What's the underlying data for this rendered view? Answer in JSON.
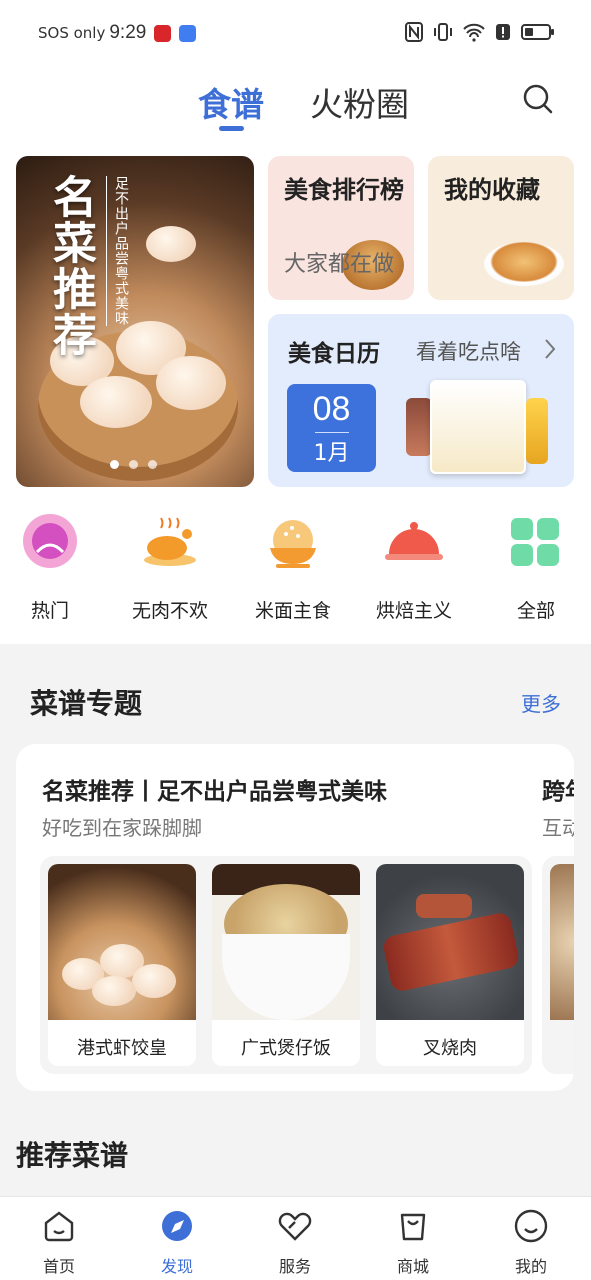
{
  "status_bar": {
    "carrier": "SOS only",
    "time": "9:29",
    "badge_colors": [
      "#d9262a",
      "#3f7df0"
    ]
  },
  "header": {
    "tabs": [
      {
        "label": "食谱",
        "active": true
      },
      {
        "label": "火粉圈",
        "active": false
      }
    ],
    "search_icon": "search-icon",
    "accent_color": "#3d6fd6"
  },
  "banner": {
    "title": "名菜推荐",
    "subtitle": "足不出户品尝粤式美味",
    "page_count": 3,
    "current_page": 1
  },
  "cards": {
    "ranking": {
      "title": "美食排行榜",
      "subtitle": "大家都在做"
    },
    "favorites": {
      "title": "我的收藏"
    },
    "calendar": {
      "title": "美食日历",
      "link": "看着吃点啥",
      "day": "08",
      "month": "1月"
    }
  },
  "categories": [
    {
      "label": "热门",
      "icon": "flower-icon"
    },
    {
      "label": "无肉不欢",
      "icon": "roast-chicken-icon"
    },
    {
      "label": "米面主食",
      "icon": "rice-bowl-icon"
    },
    {
      "label": "烘焙主义",
      "icon": "baking-dome-icon"
    },
    {
      "label": "全部",
      "icon": "grid-icon"
    }
  ],
  "recipe_topics": {
    "title": "菜谱专题",
    "more": "更多",
    "topics": [
      {
        "title": "名菜推荐丨足不出户品尝粤式美味",
        "subtitle": "好吃到在家跺脚脚",
        "dishes": [
          "港式虾饺皇",
          "广式煲仔饭",
          "叉烧肉"
        ]
      },
      {
        "title": "跨年",
        "subtitle": "互动"
      }
    ]
  },
  "recommended": {
    "title": "推荐菜谱"
  },
  "bottom_nav": [
    {
      "label": "首页",
      "icon": "home-icon",
      "active": false
    },
    {
      "label": "发现",
      "icon": "discover-icon",
      "active": true
    },
    {
      "label": "服务",
      "icon": "service-icon",
      "active": false
    },
    {
      "label": "商城",
      "icon": "shopping-bag-icon",
      "active": false
    },
    {
      "label": "我的",
      "icon": "profile-icon",
      "active": false
    }
  ]
}
